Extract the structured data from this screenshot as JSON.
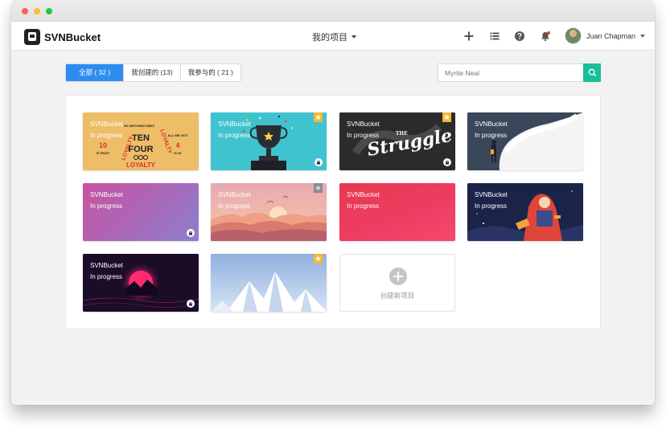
{
  "window": {
    "controls": [
      "close",
      "minimize",
      "maximize"
    ]
  },
  "navbar": {
    "logo_text": "SVNBucket",
    "center_menu": "我的项目",
    "icons": [
      "plus-icon",
      "list-icon",
      "help-icon",
      "bell-icon"
    ],
    "user_name": "Juan Chapman"
  },
  "filters": {
    "tabs": [
      {
        "label": "全部 ( 32 )",
        "active": true
      },
      {
        "label": "我创建的 (13)",
        "active": false
      },
      {
        "label": "我参与的 ( 21 )",
        "active": false
      }
    ],
    "search_placeholder": "Myrtie Neal"
  },
  "projects": [
    {
      "name": "SVNBucket",
      "status": "In progress",
      "art": "ten-four-loyalty",
      "starred": false,
      "locked": false,
      "art_text": [
        "NO SWITCHING SIDES",
        "TEN",
        "FOUR",
        "ALL WE GOT",
        "10",
        "IS TRUST",
        "4",
        "IS US",
        "LOYALTY"
      ]
    },
    {
      "name": "SVNBucket",
      "status": "In progress",
      "art": "trophy",
      "starred": true,
      "locked": true
    },
    {
      "name": "SVNBucket",
      "status": "In progress",
      "art": "struggle-lettering",
      "starred": true,
      "locked": true,
      "art_text": [
        "THE",
        "Struggle"
      ]
    },
    {
      "name": "SVNBucket",
      "status": "In progress",
      "art": "smoke-figure",
      "starred": false,
      "locked": false
    },
    {
      "name": "SVNBucket",
      "status": "In progress",
      "art": "purple-gradient",
      "starred": false,
      "locked": true
    },
    {
      "name": "SVNBucket",
      "status": "In progress",
      "art": "sunset-mountains",
      "starred": true,
      "star_muted": true,
      "locked": false
    },
    {
      "name": "SVNBucket",
      "status": "In progress",
      "art": "red-gradient",
      "starred": false,
      "locked": false
    },
    {
      "name": "SVNBucket",
      "status": "In progress",
      "art": "astronaut-night",
      "starred": false,
      "locked": false
    },
    {
      "name": "SVNBucket",
      "status": "In progress",
      "art": "neon-sun",
      "starred": false,
      "locked": true
    },
    {
      "name": "",
      "status": "",
      "art": "ice-mountains",
      "starred": true,
      "locked": false
    }
  ],
  "new_project": {
    "label": "创建新项目"
  },
  "colors": {
    "primary": "#2d8cf0",
    "search_button": "#19be9b",
    "star": "#f7b733"
  }
}
